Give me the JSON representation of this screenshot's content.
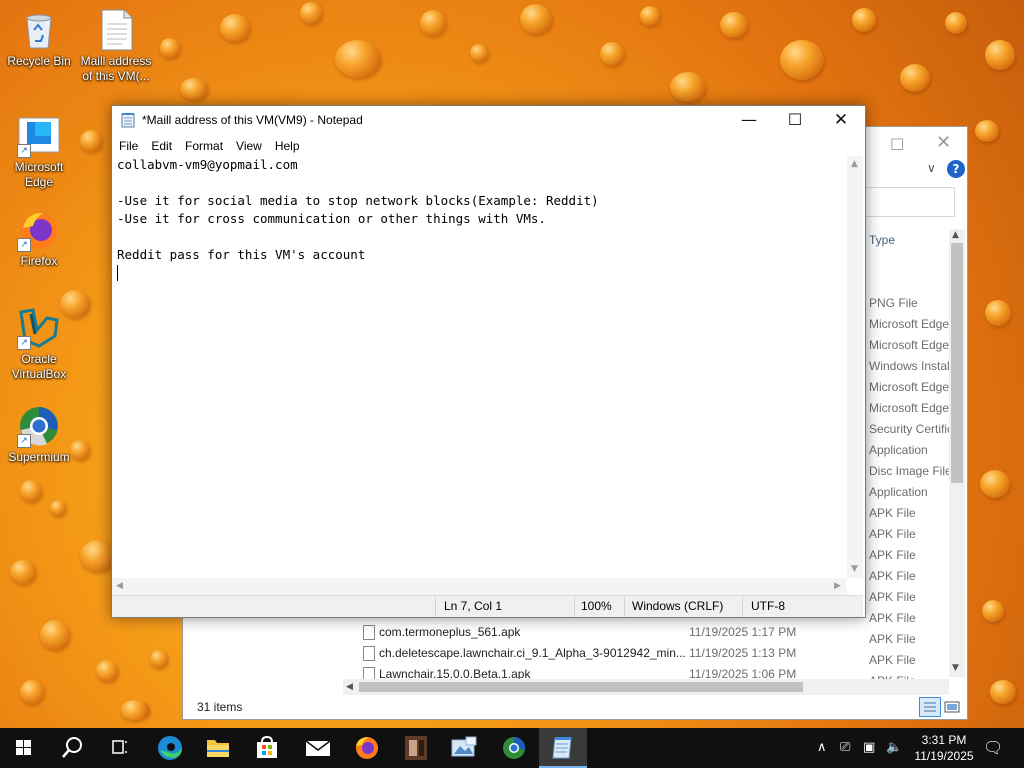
{
  "desktop": {
    "icons": [
      {
        "label": "Recycle Bin"
      },
      {
        "label": "Maill address of this VM(..."
      },
      {
        "label": "Microsoft Edge"
      },
      {
        "label": "Firefox"
      },
      {
        "label": "Oracle VirtualBox"
      },
      {
        "label": "Supermium"
      }
    ]
  },
  "explorer": {
    "type_header": "Type",
    "status": "31 items",
    "types": [
      "PNG File",
      "Microsoft Edge",
      "Microsoft Edge",
      "Windows Instal",
      "Microsoft Edge",
      "Microsoft Edge",
      "Security Certific",
      "Application",
      "Disc Image File",
      "Application",
      "APK File",
      "APK File",
      "APK File",
      "APK File",
      "APK File",
      "APK File",
      "APK File",
      "APK File",
      "APK File"
    ],
    "rows": [
      {
        "name": "com.termoneplus_561.apk",
        "date": "11/19/2025 1:17 PM"
      },
      {
        "name": "ch.deletescape.lawnchair.ci_9.1_Alpha_3-9012942_min...",
        "date": "11/19/2025 1:13 PM"
      },
      {
        "name": "Lawnchair.15.0.0.Beta.1.apk",
        "date": "11/19/2025 1:06 PM"
      }
    ]
  },
  "notepad": {
    "title": "*Maill address of this VM(VM9) - Notepad",
    "menu": [
      "File",
      "Edit",
      "Format",
      "View",
      "Help"
    ],
    "text": "collabvm-vm9@yopmail.com\n\n-Use it for social media to stop network blocks(Example: Reddit)\n-Use it for cross communication or other things with VMs.\n\nReddit pass for this VM's account\n",
    "status": {
      "position": "Ln 7, Col 1",
      "zoom": "100%",
      "line_ending": "Windows (CRLF)",
      "encoding": "UTF-8"
    }
  },
  "taskbar": {
    "time": "3:31 PM",
    "date": "11/19/2025",
    "items": [
      "start",
      "search",
      "task-view",
      "edge",
      "file-explorer",
      "store",
      "mail",
      "firefox",
      "app-1",
      "app-2",
      "supermium",
      "notepad"
    ]
  }
}
